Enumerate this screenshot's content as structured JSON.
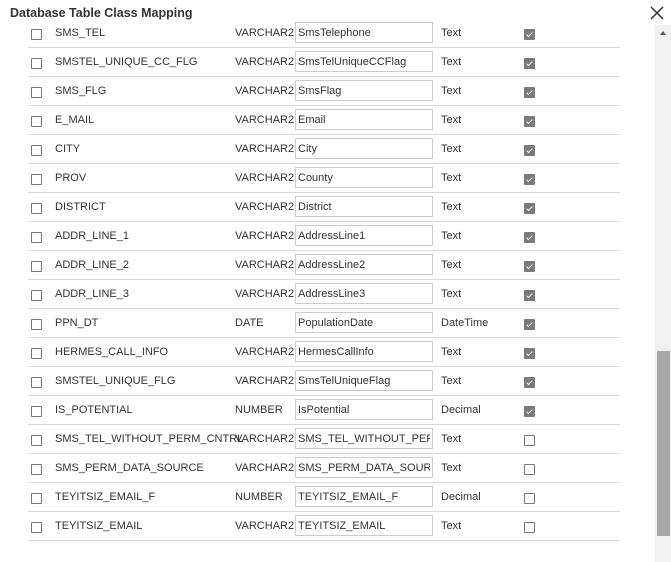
{
  "dialog": {
    "title": "Database Table Class Mapping"
  },
  "icons": {
    "close": "close-icon",
    "scroll_up": "scroll-up-arrow-icon"
  },
  "rows": [
    {
      "column": "SMS_TEL",
      "type": "VARCHAR2",
      "property": "SmsTelephone",
      "class": "Text",
      "selected": false,
      "mapped": true
    },
    {
      "column": "SMSTEL_UNIQUE_CC_FLG",
      "type": "VARCHAR2",
      "property": "SmsTelUniqueCCFlag",
      "class": "Text",
      "selected": false,
      "mapped": true
    },
    {
      "column": "SMS_FLG",
      "type": "VARCHAR2",
      "property": "SmsFlag",
      "class": "Text",
      "selected": false,
      "mapped": true
    },
    {
      "column": "E_MAIL",
      "type": "VARCHAR2",
      "property": "Email",
      "class": "Text",
      "selected": false,
      "mapped": true
    },
    {
      "column": "CITY",
      "type": "VARCHAR2",
      "property": "City",
      "class": "Text",
      "selected": false,
      "mapped": true
    },
    {
      "column": "PROV",
      "type": "VARCHAR2",
      "property": "County",
      "class": "Text",
      "selected": false,
      "mapped": true
    },
    {
      "column": "DISTRICT",
      "type": "VARCHAR2",
      "property": "District",
      "class": "Text",
      "selected": false,
      "mapped": true
    },
    {
      "column": "ADDR_LINE_1",
      "type": "VARCHAR2",
      "property": "AddressLine1",
      "class": "Text",
      "selected": false,
      "mapped": true
    },
    {
      "column": "ADDR_LINE_2",
      "type": "VARCHAR2",
      "property": "AddressLine2",
      "class": "Text",
      "selected": false,
      "mapped": true
    },
    {
      "column": "ADDR_LINE_3",
      "type": "VARCHAR2",
      "property": "AddressLine3",
      "class": "Text",
      "selected": false,
      "mapped": true
    },
    {
      "column": "PPN_DT",
      "type": "DATE",
      "property": "PopulationDate",
      "class": "DateTime",
      "selected": false,
      "mapped": true
    },
    {
      "column": "HERMES_CALL_INFO",
      "type": "VARCHAR2",
      "property": "HermesCallInfo",
      "class": "Text",
      "selected": false,
      "mapped": true
    },
    {
      "column": "SMSTEL_UNIQUE_FLG",
      "type": "VARCHAR2",
      "property": "SmsTelUniqueFlag",
      "class": "Text",
      "selected": false,
      "mapped": true
    },
    {
      "column": "IS_POTENTIAL",
      "type": "NUMBER",
      "property": "IsPotential",
      "class": "Decimal",
      "selected": false,
      "mapped": true
    },
    {
      "column": "SMS_TEL_WITHOUT_PERM_CNTRL",
      "type": "VARCHAR2",
      "property": "SMS_TEL_WITHOUT_PERM_CNTRL",
      "class": "Text",
      "selected": false,
      "mapped": false
    },
    {
      "column": "SMS_PERM_DATA_SOURCE",
      "type": "VARCHAR2",
      "property": "SMS_PERM_DATA_SOURCE",
      "class": "Text",
      "selected": false,
      "mapped": false
    },
    {
      "column": "TEYITSIZ_EMAIL_F",
      "type": "NUMBER",
      "property": "TEYITSIZ_EMAIL_F",
      "class": "Decimal",
      "selected": false,
      "mapped": false
    },
    {
      "column": "TEYITSIZ_EMAIL",
      "type": "VARCHAR2",
      "property": "TEYITSIZ_EMAIL",
      "class": "Text",
      "selected": false,
      "mapped": false
    }
  ],
  "scrollbar": {
    "scroll_position_fraction": 0.62,
    "visible_fraction": 0.35
  }
}
